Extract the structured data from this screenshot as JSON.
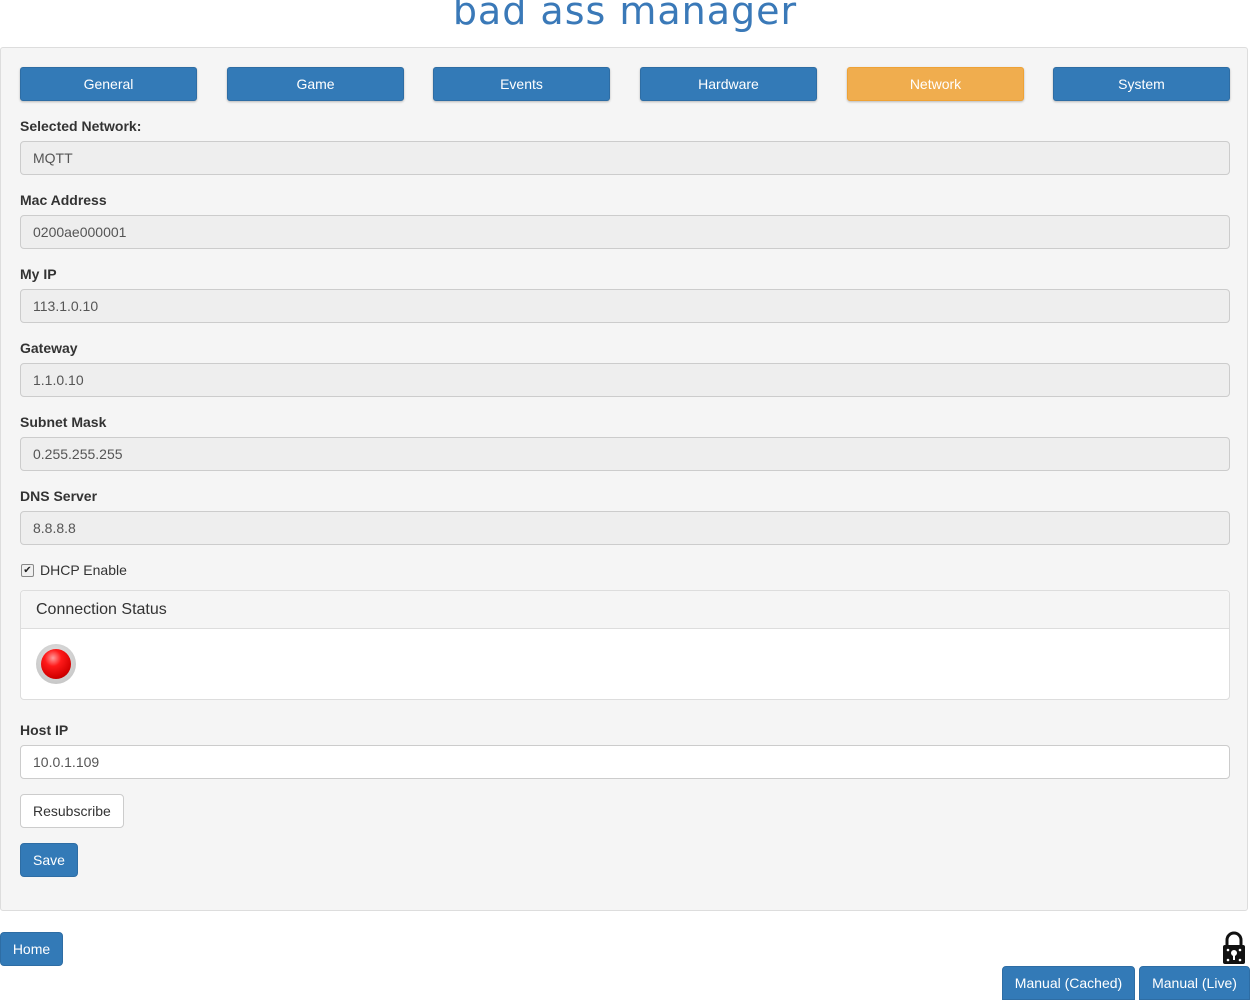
{
  "header": {
    "title": "bad ass manager"
  },
  "tabs": [
    {
      "label": "General",
      "active": false
    },
    {
      "label": "Game",
      "active": false
    },
    {
      "label": "Events",
      "active": false
    },
    {
      "label": "Hardware",
      "active": false
    },
    {
      "label": "Network",
      "active": true
    },
    {
      "label": "System",
      "active": false
    }
  ],
  "network": {
    "selected_network": {
      "label": "Selected Network:",
      "value": "MQTT"
    },
    "mac_address": {
      "label": "Mac Address",
      "value": "0200ae000001"
    },
    "my_ip": {
      "label": "My IP",
      "value": "113.1.0.10"
    },
    "gateway": {
      "label": "Gateway",
      "value": "1.1.0.10"
    },
    "subnet_mask": {
      "label": "Subnet Mask",
      "value": "0.255.255.255"
    },
    "dns_server": {
      "label": "DNS Server",
      "value": "8.8.8.8"
    },
    "dhcp": {
      "label": "DHCP Enable",
      "checked": true,
      "check_glyph": "✔"
    }
  },
  "connection_status": {
    "heading": "Connection Status",
    "state_color": "#ff0000"
  },
  "host_ip": {
    "label": "Host IP",
    "value": "10.0.1.109"
  },
  "buttons": {
    "resubscribe": "Resubscribe",
    "save": "Save",
    "home": "Home",
    "manual_cached": "Manual (Cached)",
    "manual_live": "Manual (Live)"
  },
  "icons": {
    "lock": "padlock-icon"
  },
  "colors": {
    "primary": "#337ab7",
    "active_tab": "#f0ad4e",
    "title": "#3a79b8"
  }
}
